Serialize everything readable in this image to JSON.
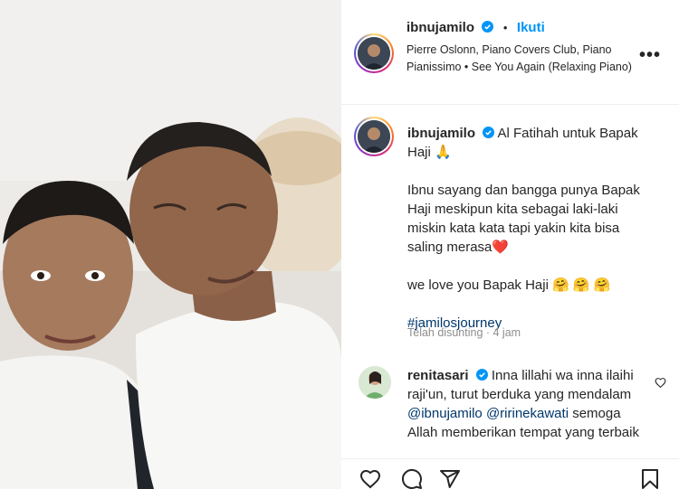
{
  "post": {
    "username": "ibnujamilo",
    "follow_label": "Ikuti",
    "music": "Pierre Oslonn, Piano Covers Club, Piano Pianissimo • See You Again (Relaxing Piano)",
    "caption_first": "Al Fatihah untuk Bapak Haji 🙏",
    "caption_paragraphs": [
      "Ibnu sayang dan bangga punya Bapak Haji meskipun kita sebagai laki-laki miskin kata kata tapi yakin kita bisa saling merasa❤️",
      "we love you Bapak Haji 🤗 🤗 🤗"
    ],
    "hashtag": "#jamilosjourney",
    "timestamp": "Telah disunting · 4 jam"
  },
  "comment": {
    "username": "renitasari",
    "text_start": "Inna lillahi wa inna ilaihi raji'un, turut berduka yang mendalam",
    "mention_1": "@ibnujamilo",
    "mention_2": "@ririnekawati",
    "text_end": "semoga Allah memberikan tempat yang terbaik"
  },
  "icons": [
    "verified-badge",
    "more-icon",
    "heart-icon",
    "comment-icon",
    "share-icon",
    "bookmark-icon"
  ],
  "colors": {
    "accent": "#0095f6",
    "link": "#00376b",
    "muted": "#8e8e8e",
    "verified": "#0095f6"
  }
}
